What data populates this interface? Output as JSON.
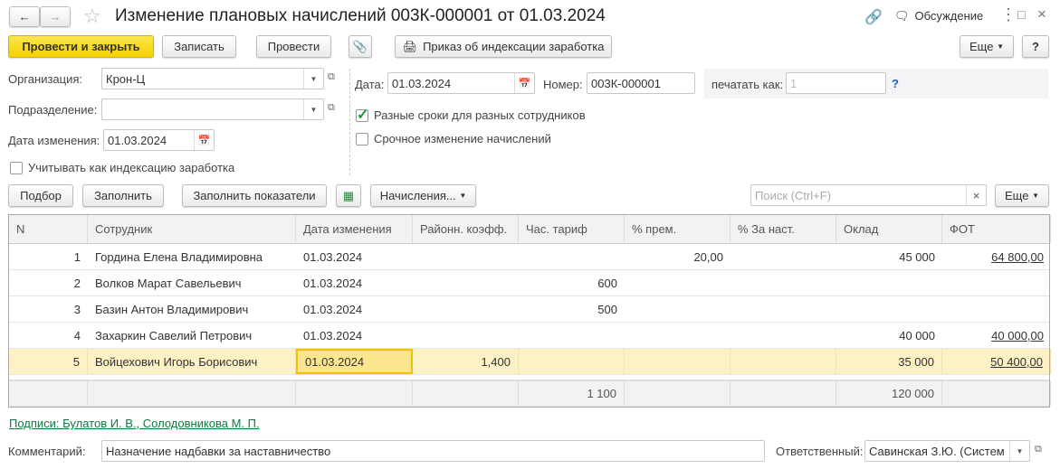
{
  "title": "Изменение плановых начислений 003К-000001 от 01.03.2024",
  "header_right": {
    "discussion": "Обсуждение"
  },
  "toolbar": {
    "post_close": "Провести и закрыть",
    "save": "Записать",
    "post": "Провести",
    "print_order": "Приказ об индексации заработка",
    "more": "Еще",
    "help": "?"
  },
  "form": {
    "org_label": "Организация:",
    "org_value": "Крон-Ц",
    "dept_label": "Подразделение:",
    "dept_value": "",
    "change_date_label": "Дата изменения:",
    "change_date_value": "01.03.2024",
    "indexation_label": "Учитывать как индексацию заработка",
    "date_label": "Дата:",
    "date_value": "01.03.2024",
    "number_label": "Номер:",
    "number_value": "003К-000001",
    "print_as_label": "печатать как:",
    "print_as_placeholder": "1",
    "print_as_help": "?",
    "diff_terms_label": "Разные сроки для разных сотрудников",
    "diff_terms_checked": true,
    "urgent_label": "Срочное изменение начислений",
    "urgent_checked": false
  },
  "table_toolbar": {
    "select": "Подбор",
    "fill": "Заполнить",
    "fill_indicators": "Заполнить показатели",
    "accruals": "Начисления...",
    "search_placeholder": "Поиск (Ctrl+F)",
    "clear": "×",
    "more": "Еще"
  },
  "table": {
    "columns": [
      "N",
      "Сотрудник",
      "Дата изменения",
      "Районн. коэфф.",
      "Час. тариф",
      "% прем.",
      "%  За наст.",
      "Оклад",
      "ФОТ"
    ],
    "rows": [
      [
        "1",
        "Гордина Елена Владимировна",
        "01.03.2024",
        "",
        "",
        "20,00",
        "",
        "45 000",
        "64 800,00"
      ],
      [
        "2",
        "Волков Марат Савельевич",
        "01.03.2024",
        "",
        "600",
        "",
        "",
        "",
        ""
      ],
      [
        "3",
        "Базин Антон Владимирович",
        "01.03.2024",
        "",
        "500",
        "",
        "",
        "",
        ""
      ],
      [
        "4",
        "Захаркин Савелий Петрович",
        "01.03.2024",
        "",
        "",
        "",
        "",
        "40 000",
        "40 000,00"
      ],
      [
        "5",
        "Войцехович Игорь Борисович",
        "01.03.2024",
        "1,400",
        "",
        "",
        "",
        "35 000",
        "50 400,00"
      ]
    ],
    "selected_row": 4,
    "totals": [
      "",
      "",
      "",
      "",
      "1 100",
      "",
      "",
      "120 000",
      ""
    ]
  },
  "signatures": "Подписи: Булатов И. В., Солодовникова М. П.",
  "comment_label": "Комментарий:",
  "comment_value": "Назначение надбавки за наставничество",
  "responsible_label": "Ответственный:",
  "responsible_value": "Савинская З.Ю. (Систем"
}
